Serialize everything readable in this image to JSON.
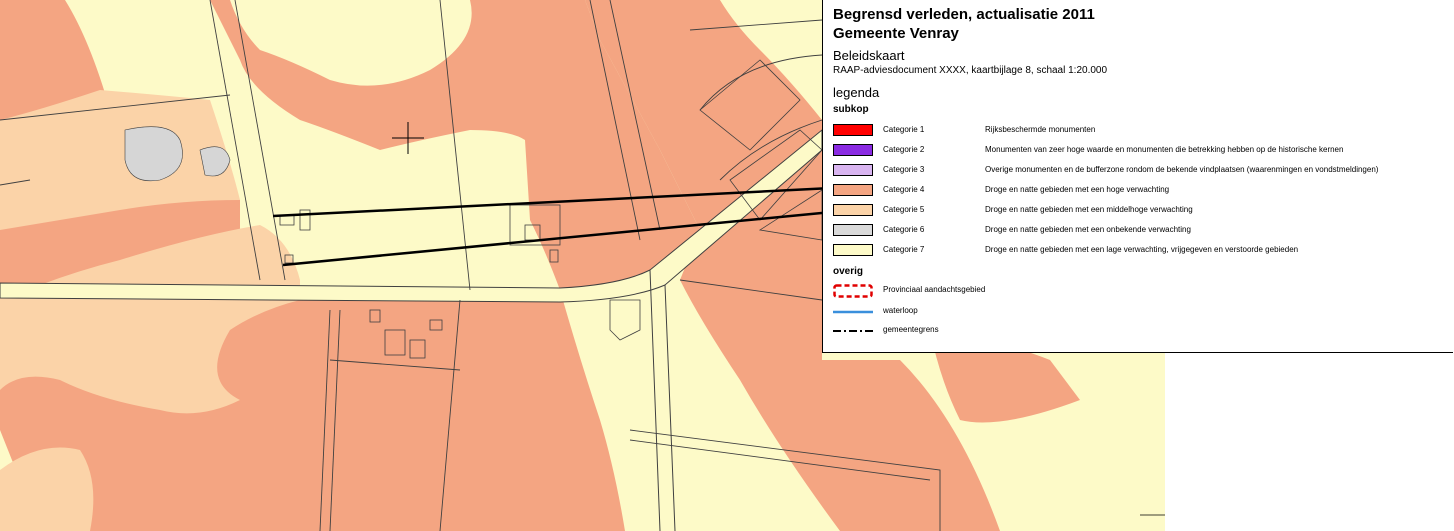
{
  "legend": {
    "title_line1": "Begrensd verleden, actualisatie 2011",
    "title_line2": "Gemeente Venray",
    "map_name": "Beleidskaart",
    "subtitle": "RAAP-adviesdocument XXXX, kaartbijlage 8, schaal 1:20.000",
    "legend_heading": "legenda",
    "section_subkop": "subkop",
    "categories": [
      {
        "label": "Categorie 1",
        "description": "Rijksbeschermde monumenten",
        "color": "#ff0000"
      },
      {
        "label": "Categorie 2",
        "description": "Monumenten van zeer hoge waarde en monumenten die betrekking hebben op de historische kernen",
        "color": "#8a2be2"
      },
      {
        "label": "Categorie 3",
        "description": "Overige monumenten en de bufferzone rondom de bekende vindplaatsen (waarenmingen en vondstmeldingen)",
        "color": "#d8b4f0"
      },
      {
        "label": "Categorie 4",
        "description": "Droge en natte gebieden met een hoge verwachting",
        "color": "#f4a582"
      },
      {
        "label": "Categorie 5",
        "description": "Droge en natte gebieden met een middelhoge verwachting",
        "color": "#fbd3a8"
      },
      {
        "label": "Categorie 6",
        "description": "Droge en natte gebieden met een onbekende verwachting",
        "color": "#d9d9d9"
      },
      {
        "label": "Categorie 7",
        "description": "Droge en natte gebieden met een lage verwachting, vrijgegeven en verstoorde gebieden",
        "color": "#fdfac8"
      }
    ],
    "section_overig": "overig",
    "overig": [
      {
        "label": "Provinciaal aandachtsgebied",
        "icon": "dashed-red-box-icon"
      },
      {
        "label": "waterloop",
        "icon": "blue-line-icon"
      },
      {
        "label": "gemeentegrens",
        "icon": "dash-dot-line-icon"
      }
    ]
  },
  "map": {
    "colors": {
      "high": "#f4a582",
      "middle": "#fbd3a8",
      "low": "#fdfac8",
      "parcel": "#d6d6d6",
      "road": "#fdfac8",
      "lines": "#404040"
    },
    "markers": [
      "crosshair-icon"
    ]
  }
}
